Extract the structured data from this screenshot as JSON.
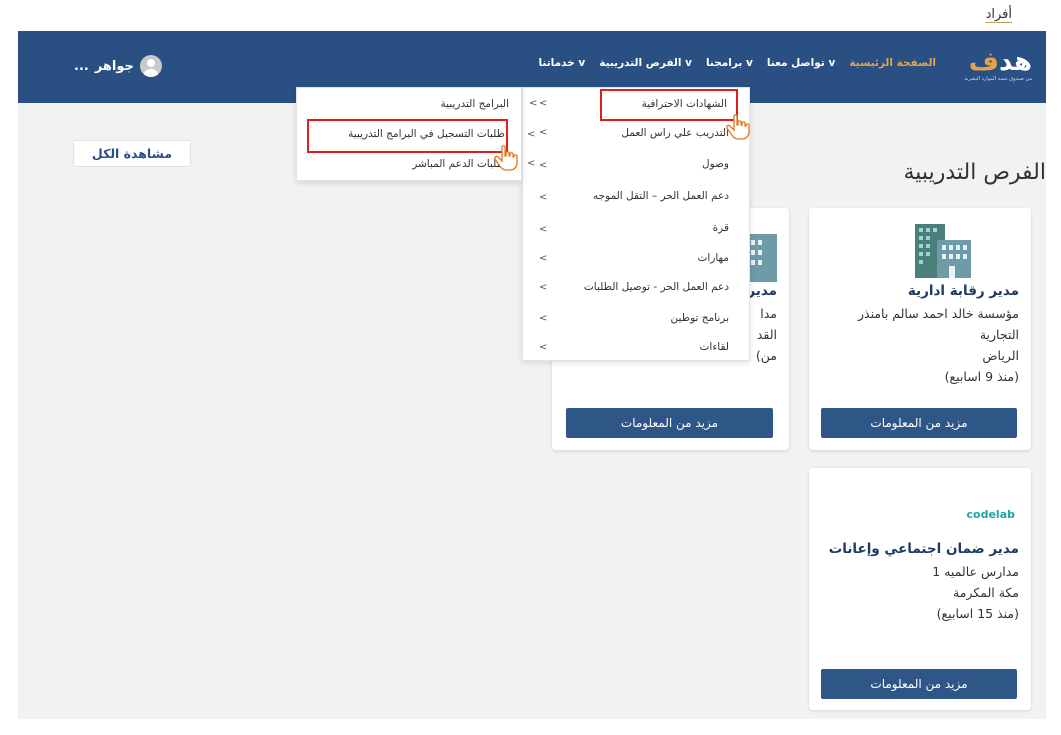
{
  "top_link": "أفراد",
  "brand": {
    "name_part1": "هد",
    "name_part2": "ف",
    "tagline": "من صندوق تنمية الموارد البشرية"
  },
  "nav": {
    "items": [
      "الصفحة الرئيسية",
      "تواصل معنا ⅴ",
      "برامجنا ⅴ",
      "الفرص التدريبية ⅴ",
      "خدماتنا ⅴ"
    ]
  },
  "user": {
    "name": "جواهر",
    "more": "..."
  },
  "section": {
    "title": "الفرص التدريبية",
    "view_all": "مشاهدة الكل"
  },
  "cards": [
    {
      "title": "مدير رقابة ادارية",
      "lines": [
        "مؤسسة خالد احمد سالم بامنذر",
        "التجارية",
        "الرياض",
        "(منذ 9 اسابيع)"
      ],
      "button": "مزيد من المعلومات",
      "logo": "building-icon"
    },
    {
      "title": "مدير",
      "lines": [
        "مدا",
        "القد",
        "(من"
      ],
      "button": "مزيد من المعلومات",
      "logo": "building-icon"
    },
    {
      "title": "مدير ضمان اجتماعي وإعانات",
      "lines": [
        "مدارس عالميه 1",
        "مكة المكرمة",
        "(منذ 15 اسابيع)"
      ],
      "button": "مزيد من المعلومات",
      "logo_text": "codelab"
    }
  ],
  "menu_main": [
    "الشهادات الاحترافية",
    "التدريب علي راس العمل",
    "وصول",
    "دعم العمل الحر – التقل الموجه",
    "قرة",
    "مهارات",
    "دعم العمل الحر - توصيل الطلبات",
    "برنامج توطين",
    "لقاءات"
  ],
  "menu_arrow": "<",
  "menu_sub": [
    "البرامج التدريبية",
    "طلبات التسجيل في البرامج التدريبية",
    "طلبات الدعم المباشر"
  ],
  "colors": {
    "navbar": "#2a5083",
    "accent": "#e2a44a",
    "highlight": "#e21d1d",
    "button": "#2e5787"
  }
}
